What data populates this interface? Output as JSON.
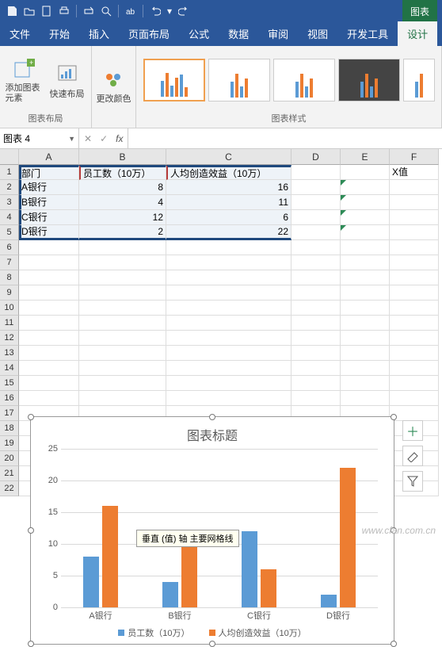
{
  "qat_title_fragment": "图表",
  "tabs": {
    "file": "文件",
    "home": "开始",
    "insert": "插入",
    "layout": "页面布局",
    "formula": "公式",
    "data": "数据",
    "review": "审阅",
    "view": "视图",
    "dev": "开发工具",
    "design": "设计"
  },
  "ribbon": {
    "group1_label": "图表布局",
    "group2_label": "图表样式",
    "btn_add_element": "添加图表元素",
    "btn_quick_layout": "快速布局",
    "btn_change_colors": "更改颜色"
  },
  "name_box": "图表 4",
  "table": {
    "headers": {
      "A": "部门",
      "B": "员工数（10万）",
      "C": "人均创造效益（10万）",
      "F": "X值"
    },
    "rows": [
      {
        "A": "A银行",
        "B": 8,
        "C": 16
      },
      {
        "A": "B银行",
        "B": 4,
        "C": 11
      },
      {
        "A": "C银行",
        "B": 12,
        "C": 6
      },
      {
        "A": "D银行",
        "B": 2,
        "C": 22
      }
    ]
  },
  "tooltip": "垂直 (值) 轴 主要网格线",
  "chart_data": {
    "type": "bar",
    "title": "图表标题",
    "xlabel": "",
    "ylabel": "",
    "categories": [
      "A银行",
      "B银行",
      "C银行",
      "D银行"
    ],
    "series": [
      {
        "name": "员工数（10万）",
        "values": [
          8,
          4,
          12,
          2
        ],
        "color": "#5b9bd5"
      },
      {
        "name": "人均创造效益（10万）",
        "values": [
          16,
          11,
          6,
          22
        ],
        "color": "#ed7d31"
      }
    ],
    "yticks": [
      0,
      5,
      10,
      15,
      20,
      25
    ],
    "ylim": [
      0,
      25
    ]
  },
  "watermark": "www.cfan.com.cn"
}
